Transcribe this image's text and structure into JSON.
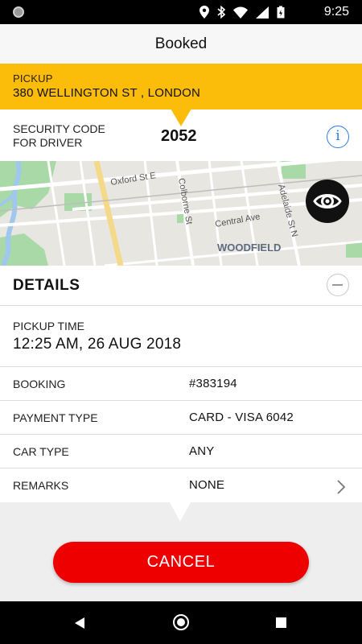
{
  "status_bar": {
    "time": "9:25",
    "icons": [
      "app-circle-icon",
      "location-icon",
      "bluetooth-icon",
      "wifi-icon",
      "signal-icon",
      "battery-icon"
    ]
  },
  "header": {
    "title": "Booked"
  },
  "pickup": {
    "label": "PICKUP",
    "address": "380 WELLINGTON ST , LONDON",
    "color": "#fbbc0a"
  },
  "security": {
    "label": "SECURITY CODE FOR DRIVER",
    "code": "2052",
    "info_glyph": "i"
  },
  "map": {
    "labels": {
      "oxford": "Oxford St E",
      "colborne": "Colborne St",
      "central": "Central Ave",
      "adelaide": "Adelaide St N",
      "woodfield": "WOODFIELD"
    },
    "view_icon": "eye-icon"
  },
  "details": {
    "title": "DETAILS",
    "pickup_time_label": "PICKUP TIME",
    "pickup_time_value": "12:25 AM, 26 AUG 2018",
    "rows": [
      {
        "label": "BOOKING",
        "value": "#383194"
      },
      {
        "label": "PAYMENT TYPE",
        "value": "CARD - VISA 6042"
      },
      {
        "label": "CAR TYPE",
        "value": "ANY"
      },
      {
        "label": "REMARKS",
        "value": "NONE"
      }
    ]
  },
  "actions": {
    "cancel_label": "CANCEL",
    "cancel_color": "#ee0000"
  },
  "nav": {
    "icons": [
      "back-icon",
      "home-icon",
      "recents-icon"
    ]
  }
}
